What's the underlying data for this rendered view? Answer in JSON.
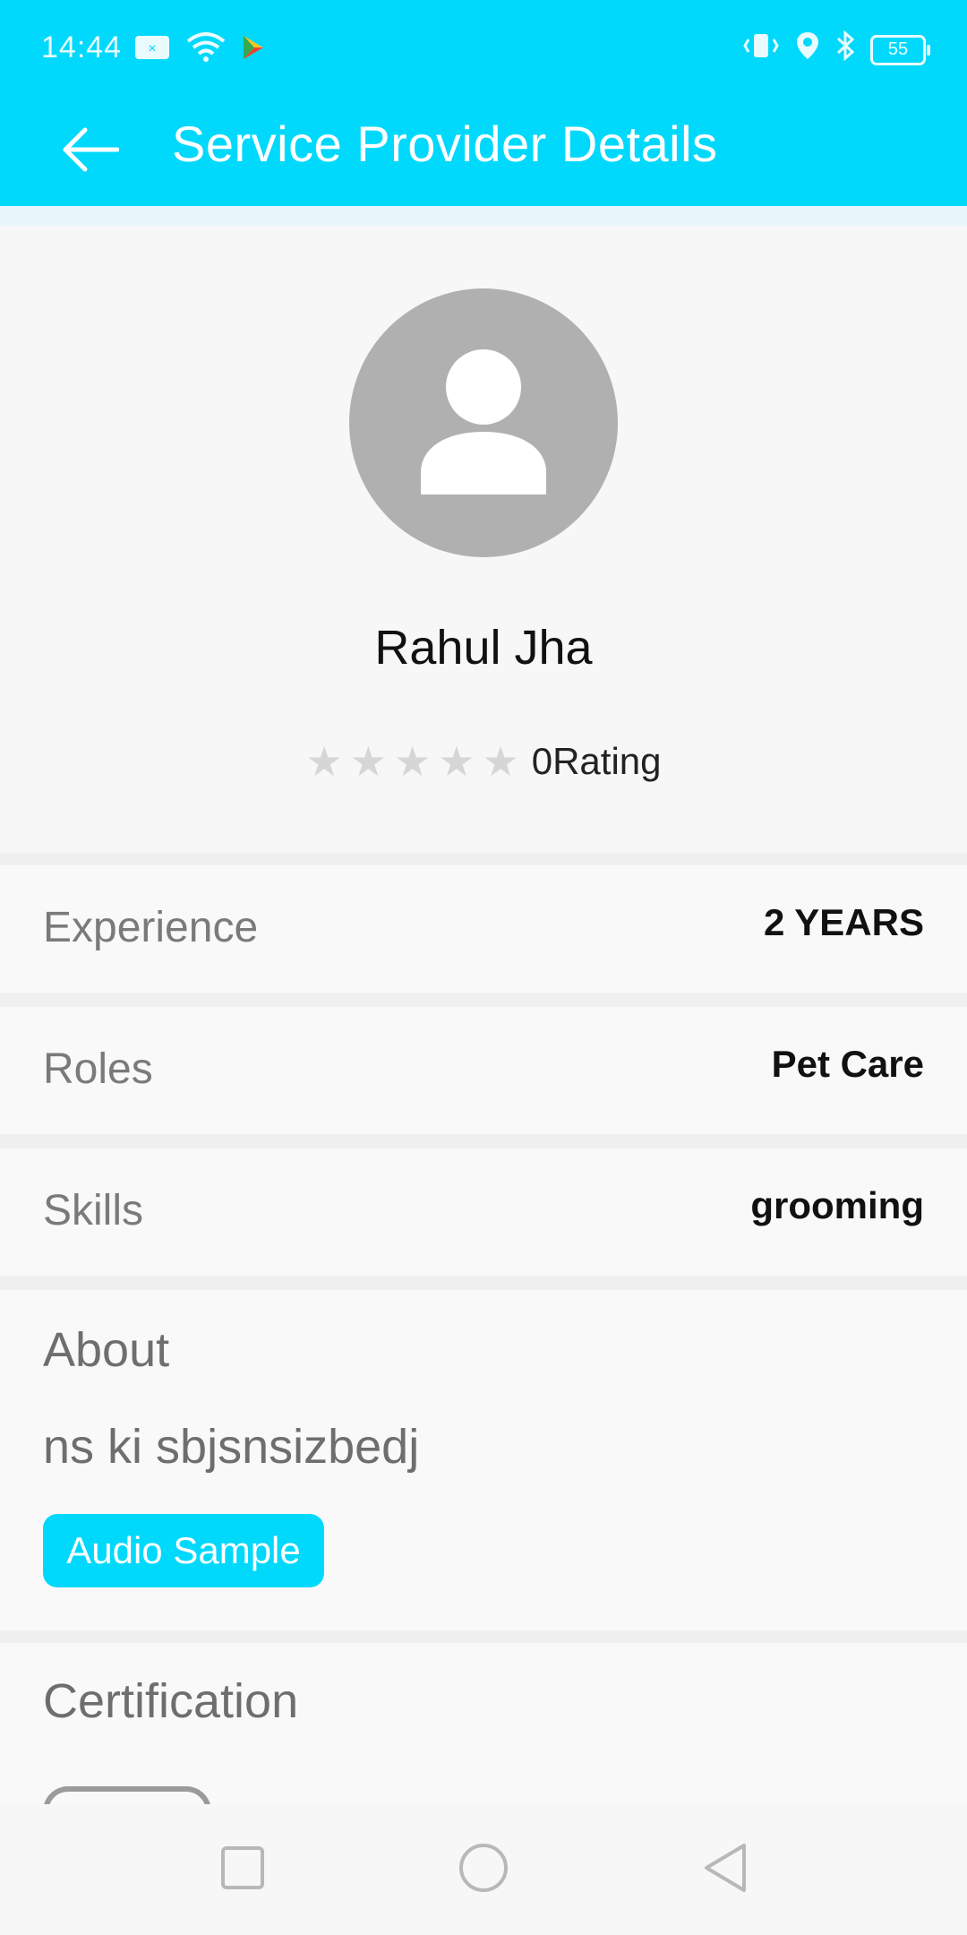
{
  "status_bar": {
    "time": "14:44",
    "battery": "55"
  },
  "app_bar": {
    "title": "Service Provider Details"
  },
  "profile": {
    "name": "Rahul Jha",
    "rating_text": "0Rating",
    "stars": 0
  },
  "details": [
    {
      "label": "Experience",
      "value": "2 YEARS"
    },
    {
      "label": "Roles",
      "value": "Pet Care"
    },
    {
      "label": "Skills",
      "value": "grooming"
    }
  ],
  "about": {
    "heading": "About",
    "text": "ns ki sbjsnsizbedj",
    "audio_button": "Audio Sample"
  },
  "certification": {
    "heading": "Certification"
  },
  "colors": {
    "accent": "#00d9fb",
    "avatar_bg": "#b0b0b0",
    "star_empty": "#d6d6d6"
  }
}
